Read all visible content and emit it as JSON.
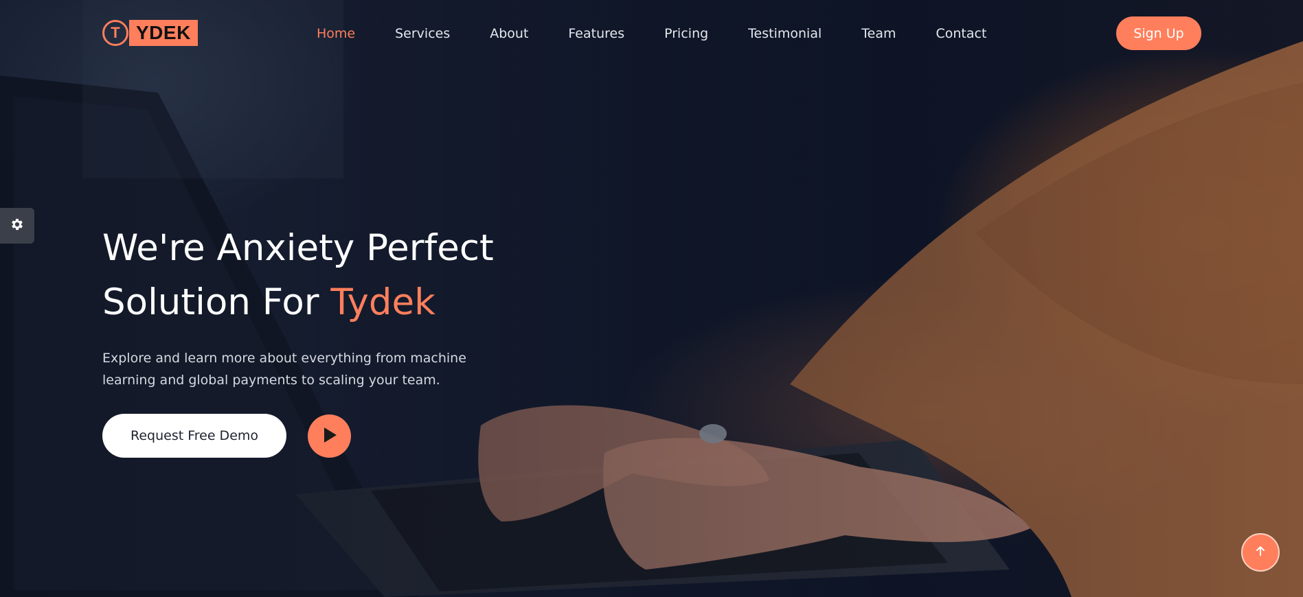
{
  "brand": {
    "logo_letter": "T",
    "logo_text": "YDEK",
    "accent_color": "#ff7f5c"
  },
  "nav": {
    "items": [
      {
        "label": "Home",
        "active": true
      },
      {
        "label": "Services",
        "active": false
      },
      {
        "label": "About",
        "active": false
      },
      {
        "label": "Features",
        "active": false
      },
      {
        "label": "Pricing",
        "active": false
      },
      {
        "label": "Testimonial",
        "active": false
      },
      {
        "label": "Team",
        "active": false
      },
      {
        "label": "Contact",
        "active": false
      }
    ],
    "signup_label": "Sign Up"
  },
  "hero": {
    "title_line1": "We're Anxiety Perfect",
    "title_line2_prefix": "Solution For ",
    "title_line2_accent": "Tydek",
    "description": "Explore and learn more about everything from machine learning and global payments to scaling your team.",
    "demo_button_label": "Request Free Demo"
  },
  "icons": {
    "settings": "gear-icon",
    "play": "play-icon",
    "back_to_top": "arrow-up-icon"
  }
}
